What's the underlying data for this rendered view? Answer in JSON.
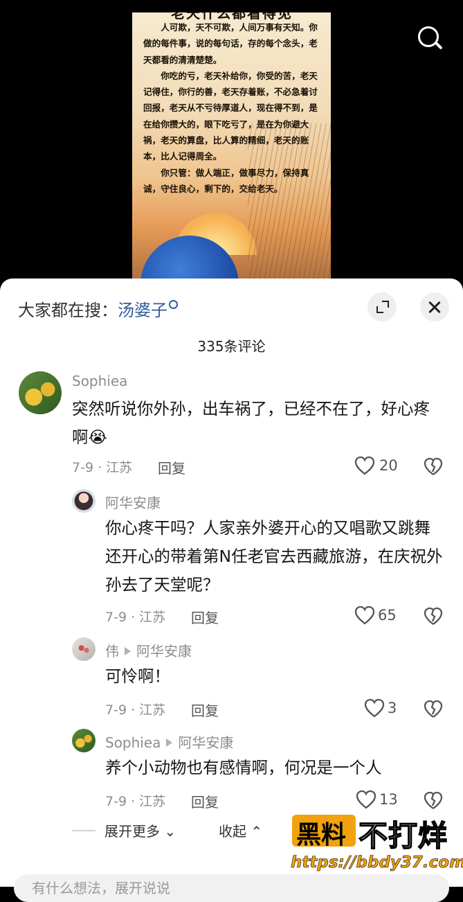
{
  "video": {
    "poster_title": "老天什么都看得见",
    "poster_paragraphs": [
      "人可欺，天不可欺，人间万事有天知。你做的每件事，说的每句话，存的每个念头，老天都看的清清楚楚。",
      "你吃的亏，老天补给你，你受的苦，老天记得住，你行的善，老天存着账，不必急着讨回报，老天从不亏待厚道人，现在得不到，是在给你攒大的，眼下吃亏了，是在为你避大祸，老天的算盘，比人算的精细，老天的账本，比人记得周全。",
      "你只管：做人端正，做事尽力，保持真诚，守住良心，剩下的，交给老天。"
    ],
    "search_icon": "search-icon"
  },
  "sheet": {
    "hot_search_prefix": "大家都在搜：",
    "hot_search_keyword": "汤婆子",
    "comment_count": "335条评论",
    "expand_icon": "expand-icon",
    "close_icon": "close-icon"
  },
  "comments": [
    {
      "user": "Sophiea",
      "text": "突然听说你外孙，出车祸了，已经不在了，好心疼啊😭",
      "date_loc": "7-9 · 江苏",
      "reply": "回复",
      "likes": "20"
    },
    {
      "user": "阿华安康",
      "text": "你心疼干吗？人家亲外婆开心的又唱歌又跳舞还开心的带着第N任老官去西藏旅游，在庆祝外孙去了天堂呢？",
      "date_loc": "7-9 · 江苏",
      "reply": "回复",
      "likes": "65"
    },
    {
      "user": "伟",
      "reply_to": "阿华安康",
      "text": "可怜啊！",
      "date_loc": "7-9 · 江苏",
      "reply": "回复",
      "likes": "3"
    },
    {
      "user": "Sophiea",
      "reply_to": "阿华安康",
      "text": "养个小动物也有感情啊，何况是一个人",
      "date_loc": "7-9 · 江苏",
      "reply": "回复",
      "likes": "13"
    }
  ],
  "controls": {
    "expand_more": "展开更多",
    "collapse": "收起"
  },
  "watermark": {
    "brand_a": "黑料",
    "brand_b": "不打烊",
    "url": "https://bbdy37.com"
  },
  "input": {
    "placeholder": "有什么想法，展开说说"
  }
}
